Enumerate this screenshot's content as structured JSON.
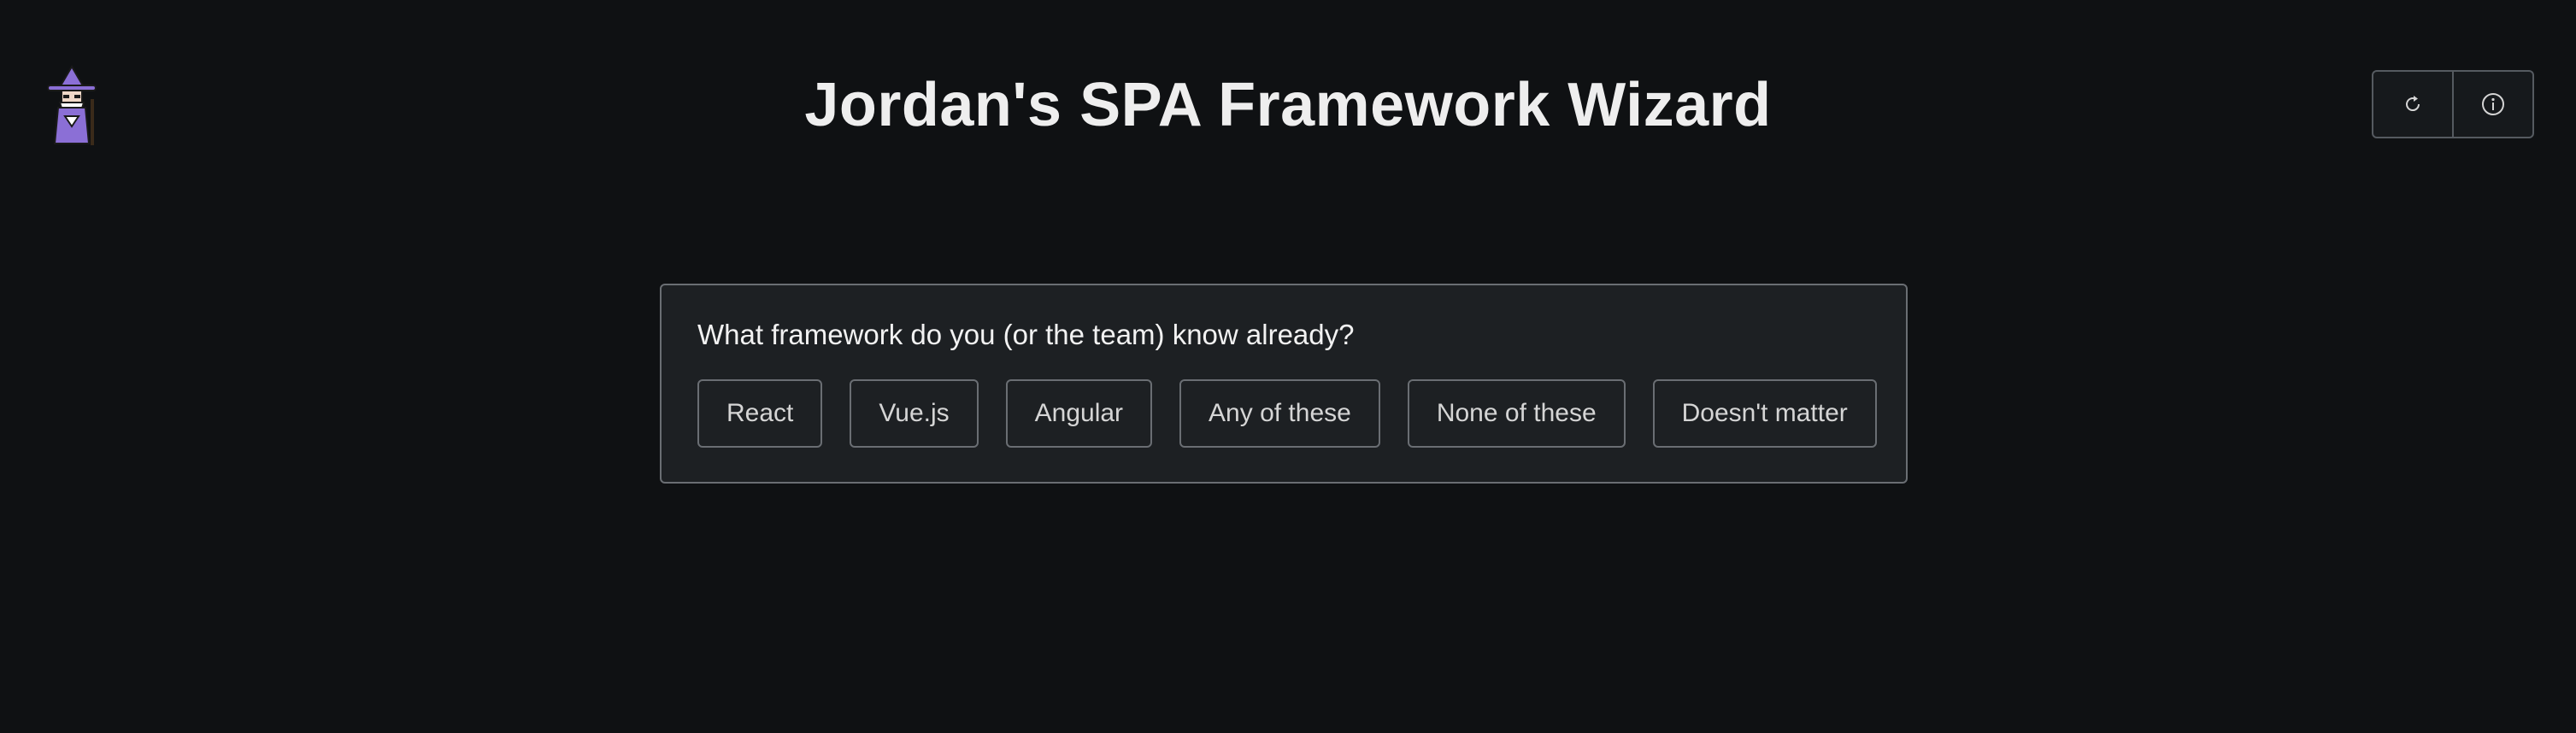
{
  "header": {
    "title": "Jordan's SPA Framework Wizard",
    "logo_icon": "wizard-icon"
  },
  "toolbar": {
    "buttons": [
      {
        "icon": "refresh-icon"
      },
      {
        "icon": "info-icon"
      }
    ]
  },
  "question_card": {
    "question": "What framework do you (or the team) know already?",
    "options": [
      "React",
      "Vue.js",
      "Angular",
      "Any of these",
      "None of these",
      "Doesn't matter"
    ]
  },
  "colors": {
    "background": "#0f1113",
    "panel": "#1d2023",
    "border": "#6a6e73",
    "text": "#e6e6e6",
    "wizard_robe": "#8b6fd6"
  }
}
